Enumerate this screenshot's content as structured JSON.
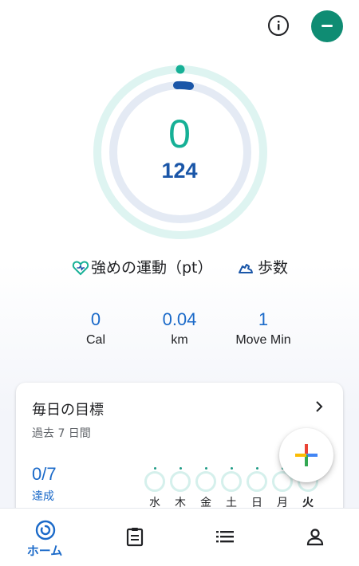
{
  "header": {
    "info_icon": "info-icon",
    "avatar_icon": "avatar-icon"
  },
  "rings": {
    "heart_points": "0",
    "steps": "124"
  },
  "legend": {
    "heart_label": "強めの運動（pt）",
    "steps_label": "歩数"
  },
  "stats": [
    {
      "value": "0",
      "label": "Cal"
    },
    {
      "value": "0.04",
      "label": "km"
    },
    {
      "value": "1",
      "label": "Move Min"
    }
  ],
  "goal_card": {
    "title": "毎日の目標",
    "subtitle": "過去 7 日間",
    "achieved_value": "0/7",
    "achieved_label": "達成",
    "days": [
      "水",
      "木",
      "金",
      "土",
      "日",
      "月",
      "火"
    ]
  },
  "bottom_nav": {
    "home_label": "ホーム"
  },
  "colors": {
    "accent_teal": "#16b096",
    "accent_blue": "#1a56a8",
    "link_blue": "#1b6ac9",
    "avatar_green": "#0f8c73"
  }
}
